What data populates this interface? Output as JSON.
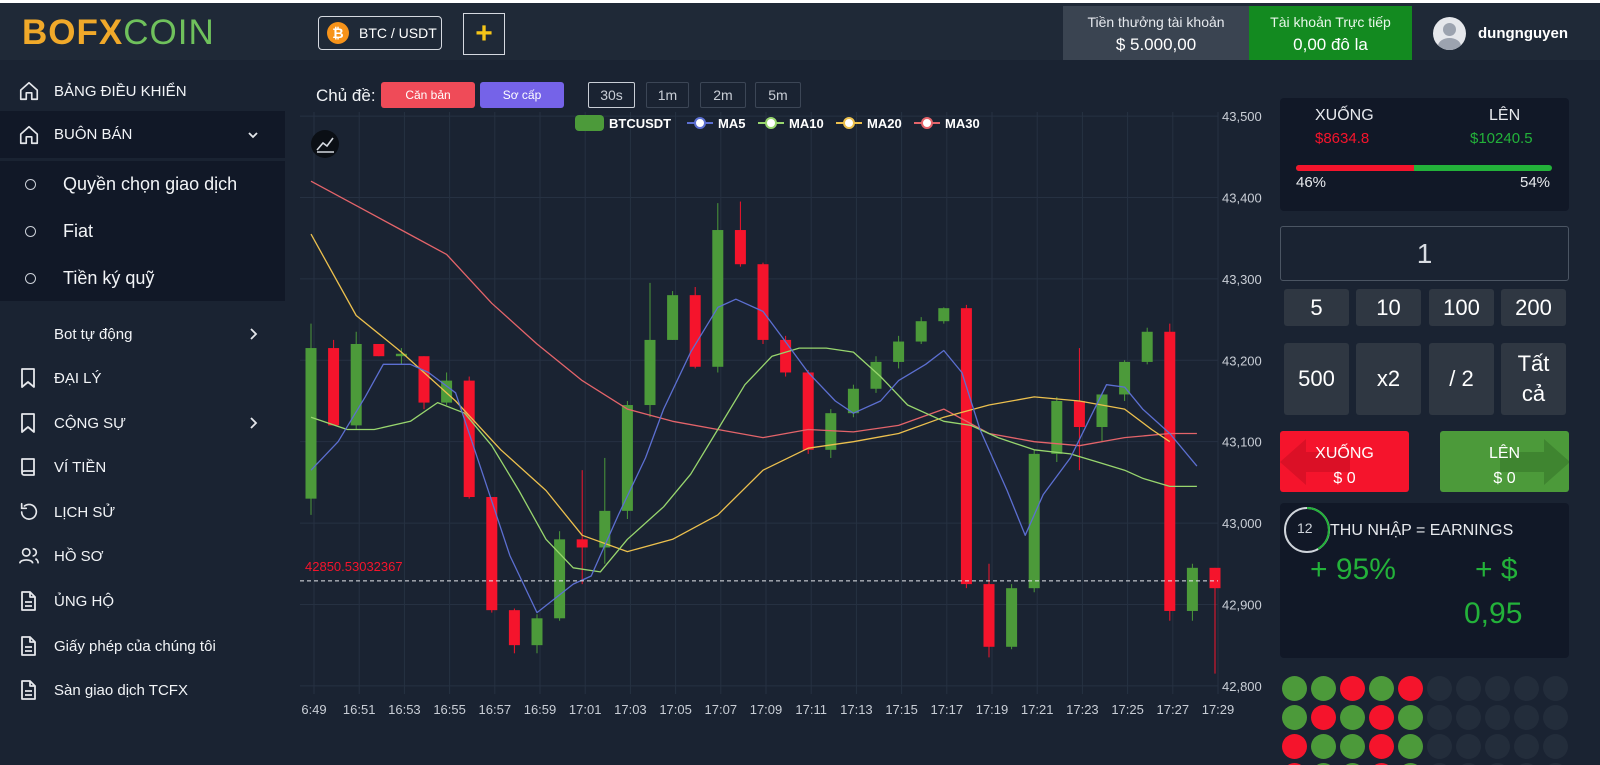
{
  "header": {
    "logo_part1": "BOFX",
    "logo_part2": "COIN",
    "pair_label": "BTC / USDT",
    "pair_coin_icon": "bitcoin-icon",
    "add_label": "+",
    "bonus_account": {
      "title": "Tiền thưởng tài khoản",
      "value": "$ 5.000,00"
    },
    "live_account": {
      "title": "Tài khoản Trực tiếp",
      "value": "0,00 đô la"
    },
    "username": "dungnguyen"
  },
  "sidebar": {
    "items": [
      {
        "label": "BẢNG ĐIỀU KHIỂN",
        "icon": "home-icon"
      },
      {
        "label": "BUÔN BÁN",
        "icon": "home-icon",
        "chevron": "⌄"
      },
      {
        "label": "Bot tự động",
        "chevron": "›"
      },
      {
        "label": "ĐẠI LÝ",
        "icon": "bookmark-icon"
      },
      {
        "label": "CỘNG SỰ",
        "icon": "bookmark-icon",
        "chevron": "›"
      },
      {
        "label": "VÍ TIỀN",
        "icon": "book-icon"
      },
      {
        "label": "LỊCH SỬ",
        "icon": "history-icon"
      },
      {
        "label": "HỒ SƠ",
        "icon": "users-icon"
      },
      {
        "label": "ỦNG HỘ",
        "icon": "document-icon"
      },
      {
        "label": "Giấy phép của chúng tôi",
        "icon": "document-icon"
      },
      {
        "label": "Sàn giao dịch TCFX",
        "icon": "document-icon"
      }
    ],
    "submenu": [
      {
        "label": "Quyền chọn giao dịch"
      },
      {
        "label": "Fiat"
      },
      {
        "label": "Tiền ký quỹ"
      }
    ]
  },
  "toolbar": {
    "theme_label": "Chủ đề:",
    "theme_basic": "Căn bản",
    "theme_primary": "Sơ cấp",
    "timeframes": [
      "30s",
      "1m",
      "2m",
      "5m"
    ],
    "selected_timeframe": "30s"
  },
  "chart_data": {
    "type": "candlestick",
    "legend": [
      "BTCUSDT",
      "MA5",
      "MA10",
      "MA20",
      "MA30"
    ],
    "colors": {
      "up": "#4c9a3a",
      "down": "#f5142c",
      "MA5": "#5c6fd1",
      "MA10": "#98d66e",
      "MA20": "#ecc04e",
      "MA30": "#e4646a"
    },
    "y_ticks": [
      "43,500",
      "43,400",
      "43,300",
      "43,200",
      "43,100",
      "43,000",
      "42,900",
      "42,800"
    ],
    "ylim": [
      42790,
      43505
    ],
    "x_labels": [
      "6:49",
      "16:51",
      "16:53",
      "16:55",
      "16:57",
      "16:59",
      "17:01",
      "17:03",
      "17:05",
      "17:07",
      "17:09",
      "17:11",
      "17:13",
      "17:15",
      "17:17",
      "17:19",
      "17:21",
      "17:23",
      "17:25",
      "17:27",
      "17:29"
    ],
    "current_price_label": "42850.53032367",
    "current_price": 42929,
    "candles": [
      {
        "o": 43030,
        "h": 43245,
        "l": 43010,
        "c": 43215
      },
      {
        "o": 43215,
        "h": 43225,
        "l": 43120,
        "c": 43120
      },
      {
        "o": 43120,
        "h": 43235,
        "l": 43115,
        "c": 43220
      },
      {
        "o": 43220,
        "h": 43220,
        "l": 43205,
        "c": 43205
      },
      {
        "o": 43205,
        "h": 43215,
        "l": 43195,
        "c": 43208
      },
      {
        "o": 43205,
        "h": 43205,
        "l": 43140,
        "c": 43148
      },
      {
        "o": 43148,
        "h": 43185,
        "l": 43145,
        "c": 43175
      },
      {
        "o": 43175,
        "h": 43180,
        "l": 43030,
        "c": 43032
      },
      {
        "o": 43032,
        "h": 43032,
        "l": 42890,
        "c": 42893
      },
      {
        "o": 42893,
        "h": 42895,
        "l": 42840,
        "c": 42850
      },
      {
        "o": 42850,
        "h": 42888,
        "l": 42840,
        "c": 42883
      },
      {
        "o": 42883,
        "h": 42990,
        "l": 42880,
        "c": 42980
      },
      {
        "o": 42980,
        "h": 43065,
        "l": 42925,
        "c": 42970
      },
      {
        "o": 42970,
        "h": 43080,
        "l": 42950,
        "c": 43015
      },
      {
        "o": 43015,
        "h": 43150,
        "l": 43005,
        "c": 43145
      },
      {
        "o": 43145,
        "h": 43295,
        "l": 43130,
        "c": 43225
      },
      {
        "o": 43225,
        "h": 43285,
        "l": 43225,
        "c": 43280
      },
      {
        "o": 43280,
        "h": 43290,
        "l": 43190,
        "c": 43192
      },
      {
        "o": 43192,
        "h": 43393,
        "l": 43185,
        "c": 43360
      },
      {
        "o": 43360,
        "h": 43395,
        "l": 43315,
        "c": 43318
      },
      {
        "o": 43318,
        "h": 43320,
        "l": 43220,
        "c": 43225
      },
      {
        "o": 43225,
        "h": 43230,
        "l": 43180,
        "c": 43185
      },
      {
        "o": 43185,
        "h": 43188,
        "l": 43085,
        "c": 43090
      },
      {
        "o": 43090,
        "h": 43140,
        "l": 43080,
        "c": 43135
      },
      {
        "o": 43135,
        "h": 43170,
        "l": 43130,
        "c": 43165
      },
      {
        "o": 43165,
        "h": 43205,
        "l": 43160,
        "c": 43198
      },
      {
        "o": 43198,
        "h": 43230,
        "l": 43190,
        "c": 43223
      },
      {
        "o": 43223,
        "h": 43253,
        "l": 43220,
        "c": 43248
      },
      {
        "o": 43248,
        "h": 43265,
        "l": 43245,
        "c": 43264
      },
      {
        "o": 43264,
        "h": 43268,
        "l": 42920,
        "c": 42925
      },
      {
        "o": 42925,
        "h": 42950,
        "l": 42835,
        "c": 42848
      },
      {
        "o": 42848,
        "h": 42925,
        "l": 42845,
        "c": 42920
      },
      {
        "o": 42920,
        "h": 43090,
        "l": 42915,
        "c": 43085
      },
      {
        "o": 43085,
        "h": 43155,
        "l": 43075,
        "c": 43150
      },
      {
        "o": 43150,
        "h": 43215,
        "l": 43065,
        "c": 43118
      },
      {
        "o": 43118,
        "h": 43160,
        "l": 43100,
        "c": 43158
      },
      {
        "o": 43158,
        "h": 43200,
        "l": 43150,
        "c": 43198
      },
      {
        "o": 43198,
        "h": 43240,
        "l": 43195,
        "c": 43235
      },
      {
        "o": 43235,
        "h": 43245,
        "l": 42880,
        "c": 42892
      },
      {
        "o": 42892,
        "h": 42950,
        "l": 42880,
        "c": 42945
      },
      {
        "o": 42945,
        "h": 42945,
        "l": 42815,
        "c": 42920
      }
    ],
    "ma_series": {
      "MA5": [
        [
          0,
          43065
        ],
        [
          0.03,
          43100
        ],
        [
          0.06,
          43155
        ],
        [
          0.08,
          43195
        ],
        [
          0.11,
          43195
        ],
        [
          0.13,
          43185
        ],
        [
          0.16,
          43160
        ],
        [
          0.19,
          43060
        ],
        [
          0.22,
          42960
        ],
        [
          0.25,
          42890
        ],
        [
          0.29,
          42925
        ],
        [
          0.31,
          42935
        ],
        [
          0.34,
          43010
        ],
        [
          0.37,
          43080
        ],
        [
          0.39,
          43140
        ],
        [
          0.42,
          43210
        ],
        [
          0.45,
          43265
        ],
        [
          0.47,
          43275
        ],
        [
          0.5,
          43260
        ],
        [
          0.52,
          43230
        ],
        [
          0.55,
          43185
        ],
        [
          0.58,
          43150
        ],
        [
          0.6,
          43135
        ],
        [
          0.63,
          43150
        ],
        [
          0.65,
          43175
        ],
        [
          0.68,
          43195
        ],
        [
          0.7,
          43212
        ],
        [
          0.72,
          43185
        ],
        [
          0.74,
          43115
        ],
        [
          0.77,
          43040
        ],
        [
          0.79,
          42985
        ],
        [
          0.81,
          43035
        ],
        [
          0.84,
          43080
        ],
        [
          0.86,
          43125
        ],
        [
          0.88,
          43170
        ],
        [
          0.9,
          43167
        ],
        [
          0.92,
          43140
        ],
        [
          0.95,
          43110
        ],
        [
          0.98,
          43070
        ]
      ],
      "MA10": [
        [
          0,
          43130
        ],
        [
          0.04,
          43115
        ],
        [
          0.07,
          43115
        ],
        [
          0.11,
          43125
        ],
        [
          0.14,
          43148
        ],
        [
          0.17,
          43135
        ],
        [
          0.2,
          43095
        ],
        [
          0.23,
          43040
        ],
        [
          0.26,
          42980
        ],
        [
          0.29,
          42945
        ],
        [
          0.32,
          42940
        ],
        [
          0.35,
          42980
        ],
        [
          0.39,
          43020
        ],
        [
          0.42,
          43060
        ],
        [
          0.45,
          43115
        ],
        [
          0.48,
          43170
        ],
        [
          0.51,
          43205
        ],
        [
          0.54,
          43215
        ],
        [
          0.57,
          43215
        ],
        [
          0.6,
          43210
        ],
        [
          0.63,
          43180
        ],
        [
          0.66,
          43145
        ],
        [
          0.7,
          43125
        ],
        [
          0.73,
          43120
        ],
        [
          0.76,
          43105
        ],
        [
          0.8,
          43090
        ],
        [
          0.84,
          43085
        ],
        [
          0.87,
          43075
        ],
        [
          0.9,
          43065
        ],
        [
          0.92,
          43055
        ],
        [
          0.95,
          43045
        ],
        [
          0.98,
          43045
        ]
      ],
      "MA20": [
        [
          0,
          43355
        ],
        [
          0.05,
          43255
        ],
        [
          0.1,
          43210
        ],
        [
          0.16,
          43150
        ],
        [
          0.21,
          43090
        ],
        [
          0.26,
          43040
        ],
        [
          0.3,
          42985
        ],
        [
          0.35,
          42965
        ],
        [
          0.4,
          42980
        ],
        [
          0.45,
          43010
        ],
        [
          0.5,
          43065
        ],
        [
          0.55,
          43092
        ],
        [
          0.6,
          43100
        ],
        [
          0.65,
          43110
        ],
        [
          0.7,
          43130
        ],
        [
          0.75,
          43145
        ],
        [
          0.8,
          43155
        ],
        [
          0.85,
          43150
        ],
        [
          0.9,
          43140
        ],
        [
          0.93,
          43115
        ],
        [
          0.95,
          43100
        ]
      ],
      "MA30": [
        [
          0,
          43420
        ],
        [
          0.05,
          43390
        ],
        [
          0.1,
          43360
        ],
        [
          0.15,
          43330
        ],
        [
          0.2,
          43270
        ],
        [
          0.25,
          43220
        ],
        [
          0.3,
          43175
        ],
        [
          0.35,
          43140
        ],
        [
          0.4,
          43125
        ],
        [
          0.45,
          43115
        ],
        [
          0.5,
          43105
        ],
        [
          0.55,
          43115
        ],
        [
          0.6,
          43112
        ],
        [
          0.65,
          43120
        ],
        [
          0.7,
          43140
        ],
        [
          0.75,
          43110
        ],
        [
          0.8,
          43100
        ],
        [
          0.85,
          43095
        ],
        [
          0.9,
          43105
        ],
        [
          0.95,
          43110
        ],
        [
          0.98,
          43110
        ]
      ]
    }
  },
  "sentiment": {
    "down_label": "XUỐNG",
    "down_value": "$8634.8",
    "up_label": "LÊN",
    "up_value": "$10240.5",
    "down_pct": "46%",
    "up_pct": "54%",
    "down_fraction": 0.46
  },
  "trade": {
    "amount": "1",
    "quick_amounts": [
      "5",
      "10",
      "100",
      "200"
    ],
    "quick_actions": [
      "500",
      "x2",
      "/ 2",
      "Tất cả"
    ],
    "down_button": {
      "label": "XUỐNG",
      "amount": "$ 0"
    },
    "up_button": {
      "label": "LÊN",
      "amount": "$ 0"
    }
  },
  "earnings": {
    "timer": "12",
    "title": "THU NHẬP = EARNINGS",
    "percent": "+ 95%",
    "amount_line1": "+ $",
    "amount_line2": "0,95"
  },
  "history": {
    "rows": [
      [
        "green",
        "green",
        "red",
        "green",
        "red"
      ],
      [
        "green",
        "red",
        "green",
        "red",
        "green"
      ],
      [
        "red",
        "green",
        "green",
        "red",
        "green"
      ],
      [
        "red",
        "green",
        "green",
        "red",
        "green"
      ]
    ]
  }
}
